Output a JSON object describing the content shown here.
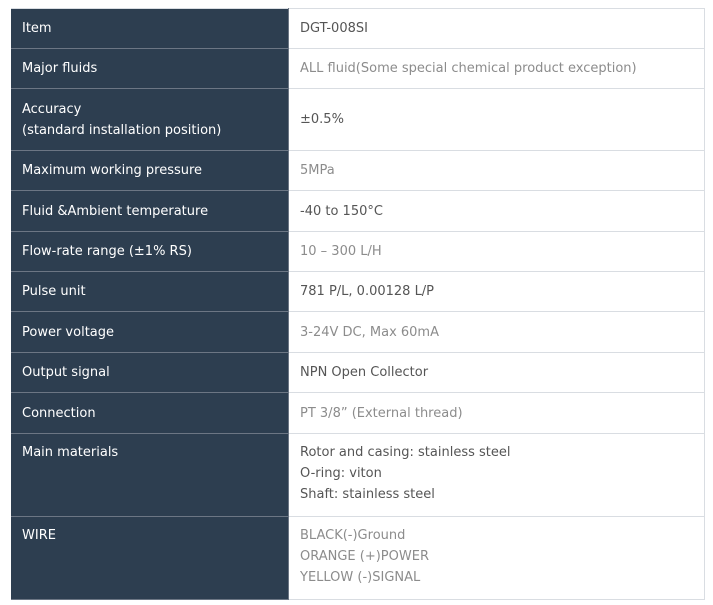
{
  "rows": [
    {
      "label": [
        "Item"
      ],
      "value": [
        "DGT-008SI"
      ],
      "muted": false
    },
    {
      "label": [
        "Major fluids"
      ],
      "value": [
        "ALL fluid(Some special chemical product exception)"
      ],
      "muted": true
    },
    {
      "label": [
        "Accuracy",
        "(standard installation position)"
      ],
      "value": [
        "±0.5%"
      ],
      "muted": false
    },
    {
      "label": [
        "Maximum working pressure"
      ],
      "value": [
        "5MPa"
      ],
      "muted": true
    },
    {
      "label": [
        "Fluid &Ambient temperature"
      ],
      "value": [
        "-40 to 150°C"
      ],
      "muted": false
    },
    {
      "label": [
        "Flow-rate range (±1% RS)"
      ],
      "value": [
        "10 – 300 L/H"
      ],
      "muted": true
    },
    {
      "label": [
        "Pulse unit"
      ],
      "value": [
        "781 P/L, 0.00128 L/P"
      ],
      "muted": false
    },
    {
      "label": [
        "Power voltage"
      ],
      "value": [
        "3-24V DC, Max 60mA"
      ],
      "muted": true
    },
    {
      "label": [
        "Output signal"
      ],
      "value": [
        "NPN Open Collector"
      ],
      "muted": false
    },
    {
      "label": [
        "Connection"
      ],
      "value": [
        "PT 3/8” (External thread)"
      ],
      "muted": true
    },
    {
      "label": [
        "Main materials"
      ],
      "value": [
        "Rotor and casing: stainless steel",
        "O-ring: viton",
        "Shaft: stainless steel"
      ],
      "muted": false
    },
    {
      "label": [
        "WIRE"
      ],
      "value": [
        "BLACK(-)Ground",
        "ORANGE (+)POWER",
        "YELLOW (-)SIGNAL"
      ],
      "muted": true
    }
  ],
  "colors": {
    "label_bg": "#2d3e50",
    "label_text": "#ffffff",
    "value_text": "#555555",
    "value_muted_text": "#8c8c8c"
  }
}
